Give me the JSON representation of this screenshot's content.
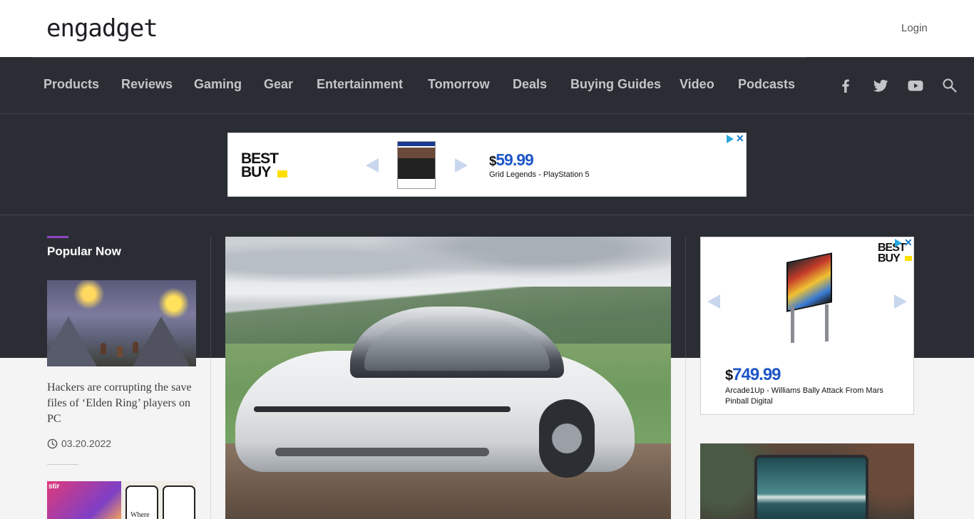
{
  "header": {
    "logo_text": "engadget",
    "login_label": "Login"
  },
  "nav": {
    "items": [
      {
        "label": "Products"
      },
      {
        "label": "Reviews"
      },
      {
        "label": "Gaming"
      },
      {
        "label": "Gear"
      },
      {
        "label": "Entertainment"
      },
      {
        "label": "Tomorrow"
      },
      {
        "label": "Deals"
      },
      {
        "label": "Buying Guides"
      },
      {
        "label": "Video"
      },
      {
        "label": "Podcasts"
      }
    ],
    "social_icons": [
      "facebook-icon",
      "twitter-icon",
      "youtube-icon",
      "search-icon"
    ]
  },
  "top_ad": {
    "brand_line1": "BEST",
    "brand_line2": "BUY",
    "price_symbol": "$",
    "price_value": "59.99",
    "product_title": "Grid Legends - PlayStation 5"
  },
  "popular": {
    "heading": "Popular Now",
    "items": [
      {
        "title": "Hackers are corrupting the save files of ‘Elden Ring’ players on PC",
        "date": "03.20.2022"
      },
      {
        "image_text": "stir",
        "phone_caption": "Where single"
      }
    ]
  },
  "side_ad": {
    "brand_line1": "BEST",
    "brand_line2": "BUY",
    "price_symbol": "$",
    "price_value": "749.99",
    "product_title": "Arcade1Up - Williams Bally Attack From Mars Pinball Digital"
  },
  "colors": {
    "dark_band": "#2b2d34",
    "accent_purple": "#8d48c3",
    "price_blue": "#1d56c7",
    "bestbuy_yellow": "#ffe000"
  }
}
